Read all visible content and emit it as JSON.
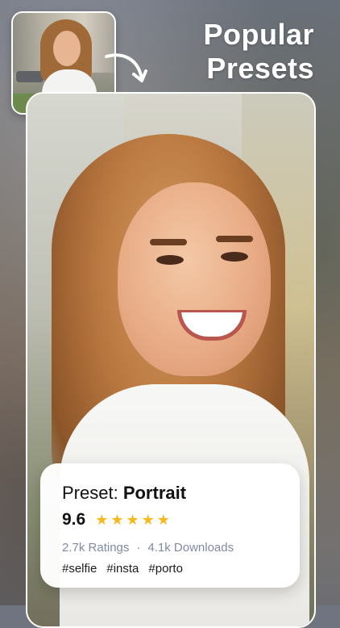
{
  "headline": {
    "line1": "Popular",
    "line2": "Presets"
  },
  "info_card": {
    "preset_prefix": "Preset: ",
    "preset_name": "Portrait",
    "score": "9.6",
    "stars": 5,
    "ratings": "2.7k Ratings",
    "separator": "·",
    "downloads": "4.1k Downloads",
    "tags": [
      "#selfie",
      "#insta",
      "#porto"
    ]
  },
  "colors": {
    "star": "#f5b91c",
    "stats_text": "#7f8aa5",
    "headline_text": "#ffffff"
  }
}
